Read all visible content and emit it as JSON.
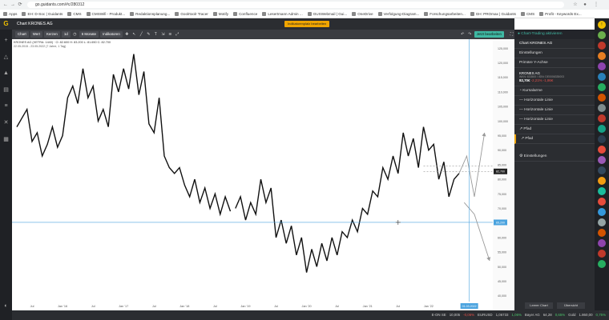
{
  "browser": {
    "url": "go.guidants.com/#c/280312",
    "bookmarks": [
      "Apps",
      "EH: D-Soc | Guidants",
      "CMS",
      "CMSWifi - Produkt...",
      "Redaktionsplanung...",
      "Goolrtoolr Tracer",
      "Motify",
      "Confluence",
      "Lesertmann Admin ...",
      "GUSWebmail | Gui...",
      "OneDrive",
      "Verfolgung-Diagram...",
      "Forschungsarbeiten...",
      "GH: PROmax | Guidants",
      "CMS",
      "Profit - Keywords Ex..."
    ]
  },
  "app": {
    "chart_title": "Chart KRONES AG",
    "alert_badge": "Indikatorenplatz bearbeiten",
    "instrument_line": "KRONES AG (XETRA: 1440)  ·  O: 82.600  H: 83.200  L: 81.650  C: 82.700",
    "date_range": "22.05.2015 - 23.05.2022   (7 Jahre, 1 Tag)",
    "toolbar": {
      "chart_label": "Chart",
      "wert_label": "Wert",
      "kerzen_label": "Kerzen",
      "interval_label": "1d",
      "period_label": "6 Monate",
      "indicators_label": "Indikatoren"
    },
    "save_btn": "Jetzt bearbeiten",
    "right_panel": {
      "header": "Chart-Trading aktivieren",
      "title": "Chart KRONES AG",
      "settings": "Einstellungen",
      "primary_axis": "Primäre Y-Achse",
      "instrument": "KRONES AG",
      "instrument_sub": "WKN: 633500 / ISIN: DE0006335003",
      "price": "82,70€",
      "change_pct": "-2,21%",
      "change_abs": "-1,86€",
      "items": [
        "Kursalarme",
        "Horizontale Linie",
        "Horizontale Linie",
        "Horizontale Linie",
        "Pfad",
        "Pfad"
      ],
      "footer_settings": "Einstellungen"
    },
    "bottom": {
      "tab_left": "Leerer Chart",
      "tab_right": "Übersicht",
      "tickers": [
        "E-ON SE",
        "10,005",
        "-0,06%",
        "EURUSD",
        "1,06733",
        "1,06%",
        "Bayer AG",
        "64,28",
        "0,65%",
        "Gold",
        "1.860,00",
        "0,75%"
      ]
    },
    "price_labels": {
      "current": "82,700",
      "crosshair": "65,200",
      "cursor_date": "01.03.2022"
    }
  },
  "chart_data": {
    "type": "line",
    "title": "Chart KRONES AG",
    "x_tick_labels": [
      "Jul",
      "Jan '16",
      "Jul",
      "Jan '17",
      "Jul",
      "Jan '18",
      "Jul",
      "Jan '19",
      "Jul",
      "Jan '20",
      "Jul",
      "Jan '21",
      "Jul",
      "Jan '22",
      "01.03.2022"
    ],
    "y_tick_labels": [
      "125,000",
      "120,000",
      "115,000",
      "110,000",
      "105,000",
      "100,000",
      "95,000",
      "90,000",
      "85,000",
      "80,000",
      "75,000",
      "70,000",
      "65,000",
      "60,000",
      "55,000",
      "50,000",
      "45,000",
      "40,000"
    ],
    "ylim": [
      38,
      127
    ],
    "x": [
      0,
      2,
      4,
      6,
      8,
      10,
      12,
      14,
      16,
      18,
      20,
      22,
      24,
      26,
      28,
      30,
      32,
      34,
      36,
      38,
      40,
      42,
      44,
      46,
      48,
      50,
      52,
      54,
      56,
      58,
      60,
      62,
      64,
      66,
      68,
      70,
      72,
      74,
      76,
      78,
      80,
      82,
      84
    ],
    "y": [
      98,
      101,
      104,
      93,
      96,
      88,
      92,
      98,
      91,
      95,
      108,
      112,
      106,
      118,
      108,
      112,
      100,
      104,
      98,
      116,
      110,
      118,
      111,
      123,
      109,
      117,
      99,
      96,
      108,
      88,
      84,
      82,
      84,
      78,
      74,
      80,
      72,
      77,
      70,
      75,
      68,
      74,
      69
    ],
    "series2_x": [
      86,
      88,
      90,
      92,
      94,
      96,
      98,
      100,
      102,
      104,
      106,
      108,
      110,
      112,
      114,
      116,
      118,
      120,
      122,
      124,
      126,
      128,
      130,
      132,
      134,
      136,
      138,
      140,
      142,
      144,
      146,
      148,
      150,
      152,
      154,
      156,
      158,
      160,
      162,
      164,
      166,
      168,
      170,
      172,
      174
    ],
    "series2_y": [
      70,
      74,
      66,
      72,
      68,
      80,
      72,
      77,
      60,
      66,
      58,
      64,
      54,
      60,
      48,
      56,
      50,
      58,
      52,
      60,
      54,
      62,
      60,
      66,
      62,
      70,
      68,
      76,
      74,
      84,
      80,
      88,
      82,
      96,
      88,
      94,
      84,
      98,
      90,
      92,
      80,
      86,
      74,
      80,
      82
    ],
    "annotations": {
      "horizontal_lines": [
        84.5,
        82.7,
        65.2
      ],
      "path_up": [
        [
          174,
          82
        ],
        [
          177,
          88
        ],
        [
          180,
          74
        ],
        [
          184,
          96
        ]
      ],
      "path_down": [
        [
          176,
          72
        ],
        [
          180,
          68
        ],
        [
          186,
          52
        ]
      ]
    }
  }
}
